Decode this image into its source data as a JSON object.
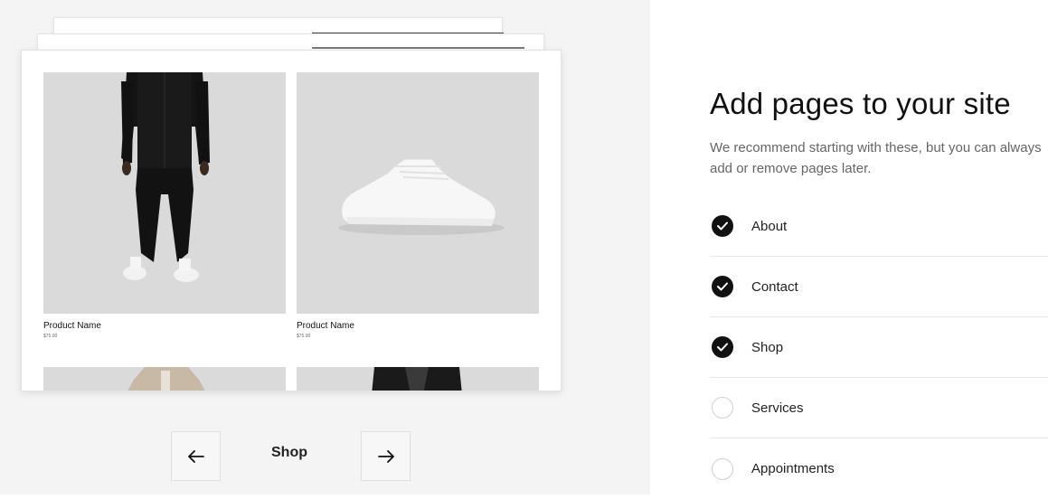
{
  "preview": {
    "products": [
      {
        "name": "Product Name",
        "price": "$75.00",
        "image": "person-in-black-outfit"
      },
      {
        "name": "Product Name",
        "price": "$75.00",
        "image": "white-sneaker"
      }
    ],
    "lower_images": [
      "beige-jacket",
      "black-leather-jacket"
    ]
  },
  "nav": {
    "current_label": "Shop",
    "prev_icon": "arrow-left-icon",
    "next_icon": "arrow-right-icon"
  },
  "panel": {
    "title": "Add pages to your site",
    "subtitle": "We recommend starting with these, but you can always add or remove pages later.",
    "pages": [
      {
        "label": "About",
        "checked": true
      },
      {
        "label": "Contact",
        "checked": true
      },
      {
        "label": "Shop",
        "checked": true
      },
      {
        "label": "Services",
        "checked": false
      },
      {
        "label": "Appointments",
        "checked": false
      }
    ]
  },
  "colors": {
    "preview_bg": "#f4f4f4",
    "image_placeholder": "#dadada",
    "check_on": "#111111"
  }
}
